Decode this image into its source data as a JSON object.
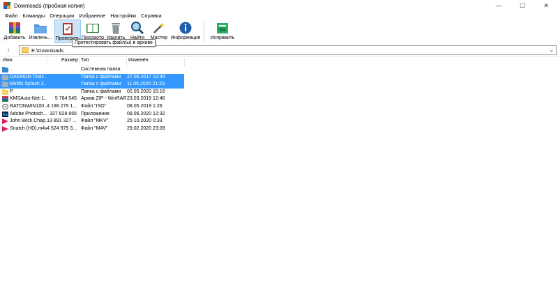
{
  "window": {
    "title": "Downloads (пробная копия)",
    "controls": {
      "minimize": "—",
      "maximize": "☐",
      "close": "✕"
    }
  },
  "menu": [
    "Файл",
    "Команды",
    "Операции",
    "Избранное",
    "Настройки",
    "Справка"
  ],
  "toolbar": {
    "buttons": [
      {
        "label": "Добавить",
        "icon": "winrar-add-icon",
        "active": false
      },
      {
        "label": "Извлечь...",
        "icon": "extract-folder-icon",
        "active": false
      },
      {
        "label": "Проверить",
        "icon": "test-clipboard-icon",
        "active": true
      },
      {
        "label": "Просмотр",
        "icon": "view-book-icon",
        "active": false
      },
      {
        "label": "Удалить",
        "icon": "delete-trash-icon",
        "active": false
      },
      {
        "label": "Найти",
        "icon": "find-magnifier-icon",
        "active": false
      },
      {
        "label": "Мастер",
        "icon": "wizard-wand-icon",
        "active": false
      },
      {
        "label": "Информация",
        "icon": "info-icon",
        "active": false
      },
      {
        "label": "Исправить",
        "icon": "repair-kit-icon",
        "active": false
      }
    ],
    "tooltip": "Протестировать файл(ы) в архиве"
  },
  "address": {
    "path": "E:\\Downloads"
  },
  "columns": {
    "name": "Имя",
    "size": "Размер",
    "type": "Тип",
    "modified": "Изменён"
  },
  "files": [
    {
      "name": "..",
      "size": "",
      "type": "Системная папка",
      "modified": "",
      "icon": "folder-up-icon",
      "selected": false
    },
    {
      "name": "DAEMON Tools ...",
      "size": "",
      "type": "Папка с файлами",
      "modified": "27.06.2017 12:49",
      "icon": "folder-icon",
      "selected": true
    },
    {
      "name": "Mirillis Splash 2...",
      "size": "",
      "type": "Папка с файлами",
      "modified": "11.05.2020 21:23",
      "icon": "folder-icon",
      "selected": true
    },
    {
      "name": "P",
      "size": "",
      "type": "Папка с файлами",
      "modified": "02.05.2020 15:16",
      "icon": "folder-icon",
      "selected": false
    },
    {
      "name": "KMSAuto-Net-1...",
      "size": "5 784 545",
      "type": "Архив ZIP - WinRAR",
      "modified": "23.03.2019 12:46",
      "icon": "zip-archive-icon",
      "selected": false
    },
    {
      "name": "RATONWIN100...",
      "size": "4 198 279 1...",
      "type": "Файл \"ISO\"",
      "modified": "08.05.2019 1:26",
      "icon": "iso-disc-icon",
      "selected": false
    },
    {
      "name": "Adobe Photosh...",
      "size": "327 828 865",
      "type": "Приложение",
      "modified": "09.06.2020 12:32",
      "icon": "photoshop-icon",
      "selected": false
    },
    {
      "name": "John.Wick.Chap...",
      "size": "13 891 327 ...",
      "type": "Файл \"MKV\"",
      "modified": "25.10.2020 0:33",
      "icon": "video-file-icon",
      "selected": false
    },
    {
      "name": "Snatch (HD).m4v",
      "size": "4 524 979 3...",
      "type": "Файл \"M4V\"",
      "modified": "29.02.2020 23:09",
      "icon": "video-file-icon",
      "selected": false
    }
  ]
}
